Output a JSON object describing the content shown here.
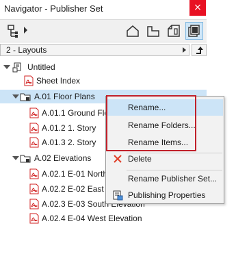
{
  "window": {
    "title": "Navigator - Publisher Set",
    "close_glyph": "×"
  },
  "toolbar": {
    "icons": [
      "set-map-icon",
      "project-map-icon",
      "view-map-icon",
      "layout-book-icon",
      "publisher-sets-icon"
    ]
  },
  "layouts_bar": {
    "selected": "2 - Layouts"
  },
  "tree": {
    "items": [
      {
        "label": "Untitled",
        "icon": "publisher-root-icon"
      },
      {
        "label": "Sheet Index",
        "icon": "pdf-icon"
      },
      {
        "label": "A.01 Floor Plans",
        "icon": "folder-icon",
        "selected": true
      },
      {
        "label": "A.01.1 Ground Flo",
        "icon": "pdf-icon"
      },
      {
        "label": "A.01.2 1. Story",
        "icon": "pdf-icon"
      },
      {
        "label": "A.01.3 2. Story",
        "icon": "pdf-icon"
      },
      {
        "label": "A.02 Elevations",
        "icon": "folder-icon"
      },
      {
        "label": "A.02.1 E-01 North",
        "icon": "pdf-icon"
      },
      {
        "label": "A.02.2 E-02 East El",
        "icon": "pdf-icon"
      },
      {
        "label": "A.02.3 E-03 South Elevation",
        "icon": "pdf-icon"
      },
      {
        "label": "A.02.4 E-04 West Elevation",
        "icon": "pdf-icon"
      }
    ]
  },
  "context_menu": {
    "items": [
      {
        "label": "Rename...",
        "highlighted": true
      },
      {
        "label": "Rename Folders..."
      },
      {
        "label": "Rename Items..."
      },
      {
        "label": "Delete",
        "icon": "delete-x-icon"
      },
      {
        "label": "Rename Publisher Set..."
      },
      {
        "label": "Publishing Properties",
        "icon": "publishing-properties-icon"
      }
    ]
  },
  "colors": {
    "selection": "#cce4f7",
    "highlight_box": "#c0202a",
    "close": "#e81123",
    "delete_icon": "#e0402a",
    "pdf_icon": "#d02020"
  }
}
